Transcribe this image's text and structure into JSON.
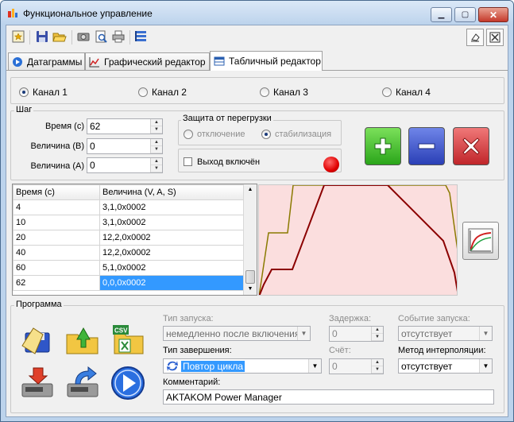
{
  "window": {
    "title": "Функциональное управление"
  },
  "tabs": [
    {
      "label": "Датаграммы"
    },
    {
      "label": "Графический редактор"
    },
    {
      "label": "Табличный редактор"
    }
  ],
  "channels": {
    "selected": 0,
    "items": [
      "Канал 1",
      "Канал 2",
      "Канал 3",
      "Канал 4"
    ]
  },
  "step": {
    "group_label": "Шаг",
    "time_label": "Время (с)",
    "time_value": "62",
    "magnitude_v_label": "Величина (В)",
    "magnitude_v_value": "0",
    "magnitude_a_label": "Величина (А)",
    "magnitude_a_value": "0"
  },
  "protection": {
    "group_label": "Защита от перегрузки",
    "option_off": "отключение",
    "option_stab": "стабилизация",
    "output_label": "Выход включён",
    "output_indicator_color": "#e00000"
  },
  "table": {
    "headers": [
      "Время (с)",
      "Величина (V, A, S)"
    ],
    "rows": [
      [
        "4",
        "3,1,0x0002"
      ],
      [
        "10",
        "3,1,0x0002"
      ],
      [
        "20",
        "12,2,0x0002"
      ],
      [
        "40",
        "12,2,0x0002"
      ],
      [
        "60",
        "5,1,0x0002"
      ],
      [
        "62",
        "0,0,0x0002"
      ]
    ],
    "selected_row": 5
  },
  "program": {
    "group_label": "Программа",
    "launch_type_label": "Тип запуска:",
    "launch_type_value": "немедленно после включения",
    "delay_label": "Задержка:",
    "delay_value": "0",
    "launch_event_label": "Событие запуска:",
    "launch_event_value": "отсутствует",
    "end_type_label": "Тип завершения:",
    "end_type_value": "Повтор цикла",
    "count_label": "Счёт:",
    "count_value": "0",
    "interp_label": "Метод интерполяции:",
    "interp_value": "отсутствует",
    "comment_label": "Комментарий:",
    "comment_value": "AKTAKOM Power Manager"
  },
  "colors": {
    "accent": "#3399ff",
    "chart_bg": "#fbdede",
    "line_dark": "#8b0000",
    "line_olive": "#8a7a00"
  }
}
